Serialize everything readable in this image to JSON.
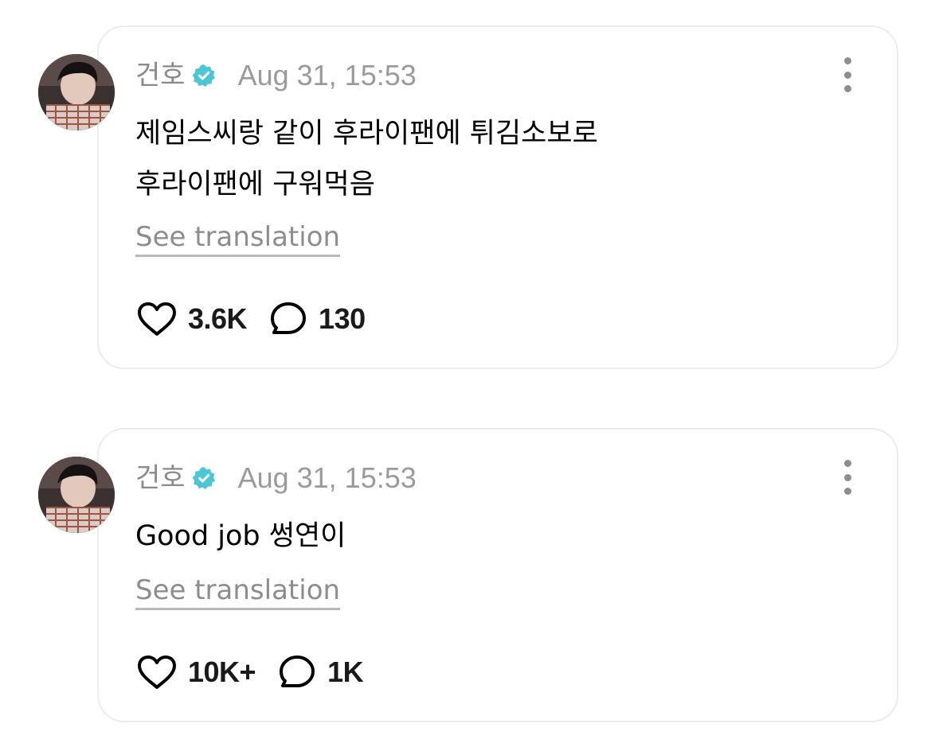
{
  "accent": {
    "verified_badge": "#4cc6d6",
    "secondary_text": "#8a8a8a"
  },
  "posts": [
    {
      "username": "건호",
      "verified": true,
      "timestamp": "Aug 31, 15:53",
      "text": "제임스씨랑 같이 후라이팬에 튀김소보로\n후라이팬에 구워먹음",
      "translate_label": "See translation",
      "likes": "3.6K",
      "replies": "130",
      "icons": {
        "like": "heart-icon",
        "reply": "speech-bubble-icon",
        "more": "more-vertical-icon",
        "badge": "verified-badge-icon"
      }
    },
    {
      "username": "건호",
      "verified": true,
      "timestamp": "Aug 31, 15:53",
      "text": "Good job 썽연이",
      "translate_label": "See translation",
      "likes": "10K+",
      "replies": "1K",
      "icons": {
        "like": "heart-icon",
        "reply": "speech-bubble-icon",
        "more": "more-vertical-icon",
        "badge": "verified-badge-icon"
      }
    }
  ]
}
